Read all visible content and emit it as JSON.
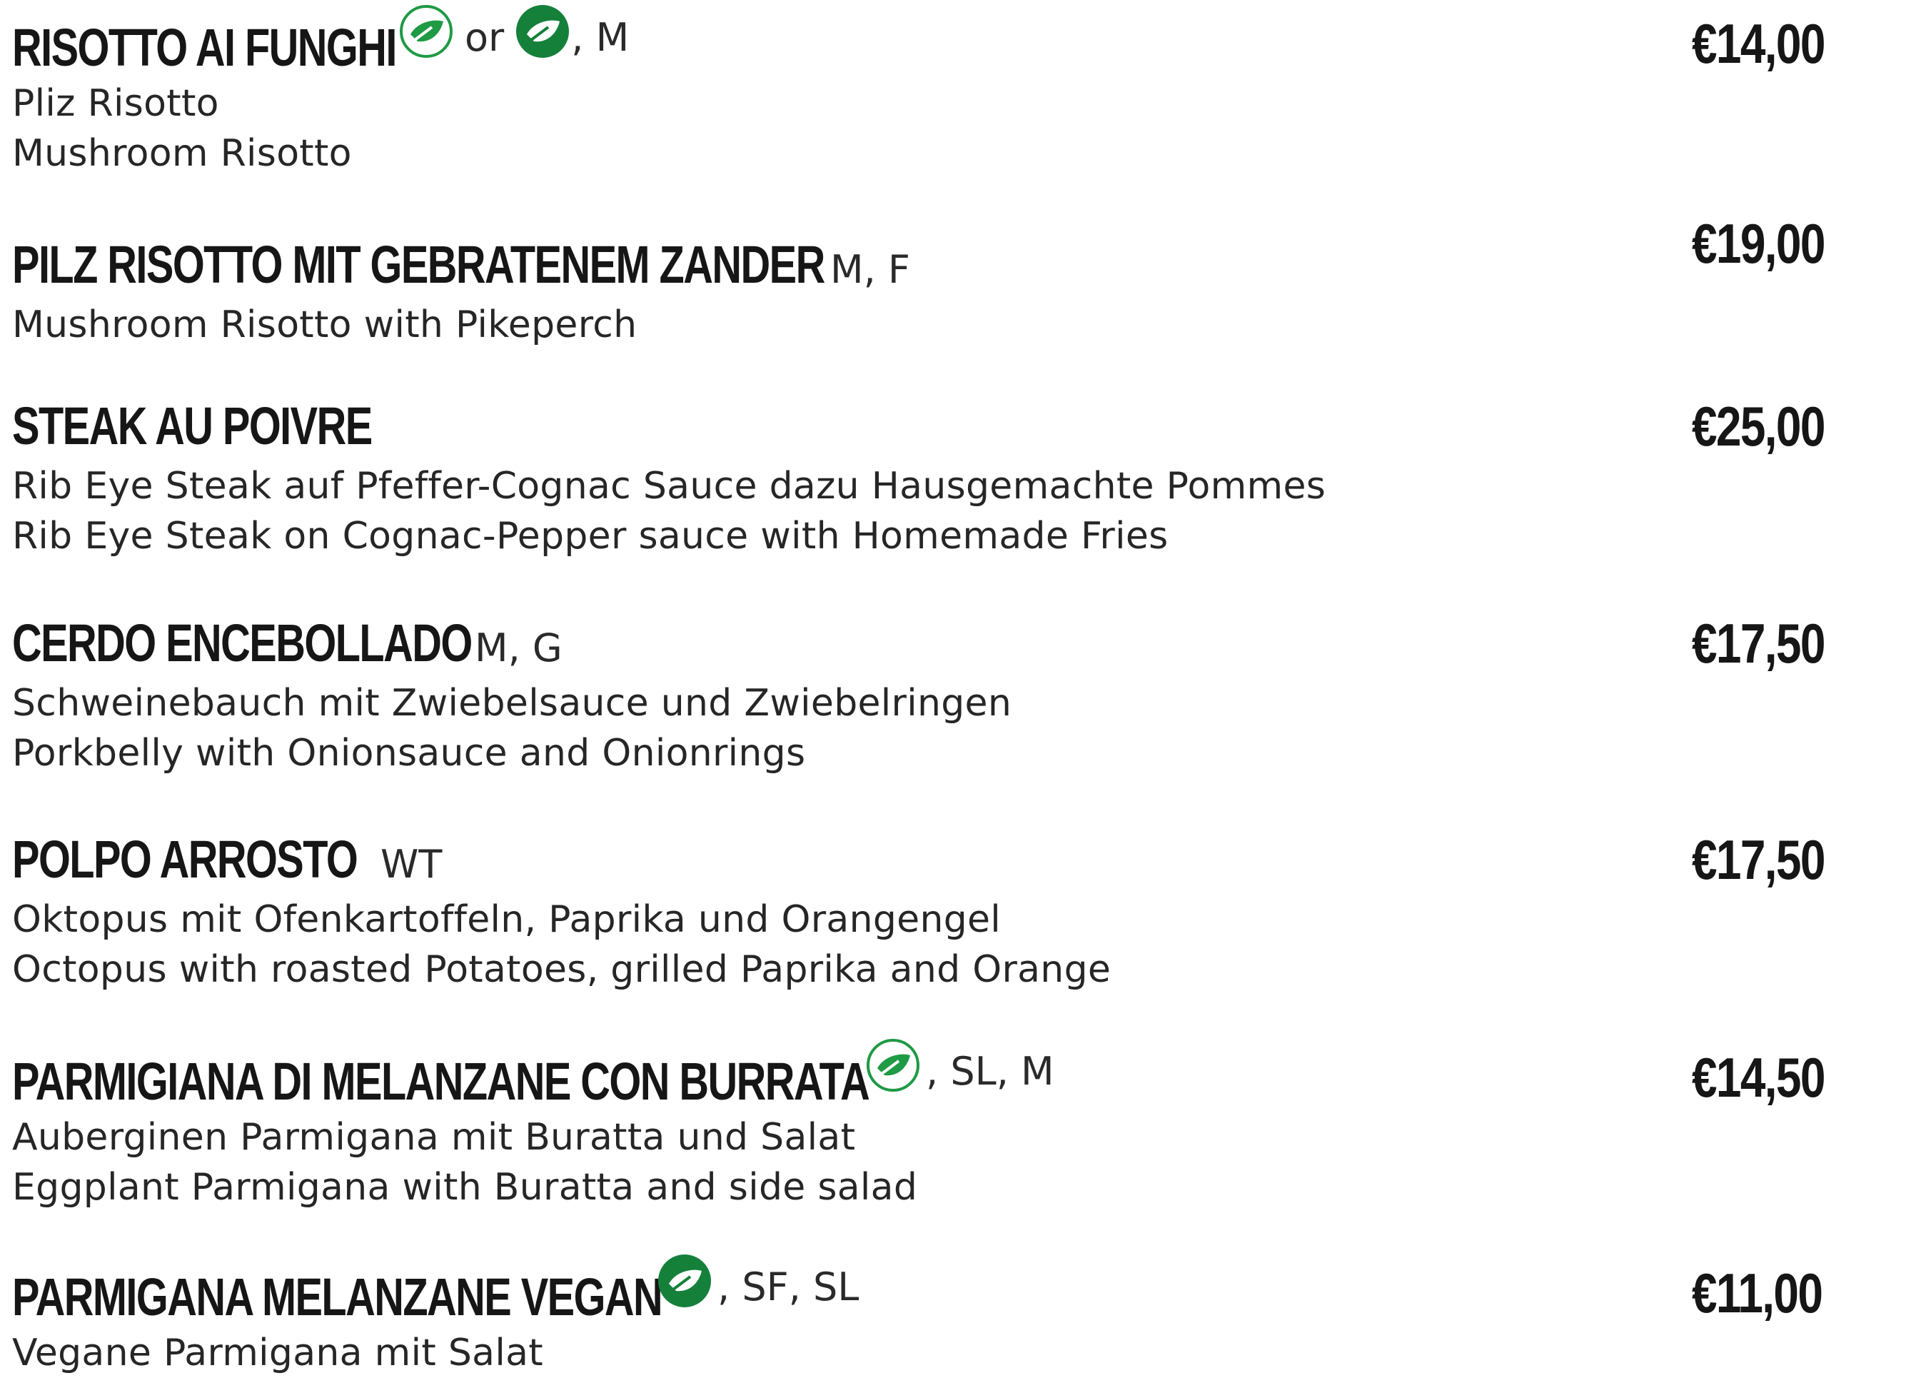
{
  "items": [
    {
      "name": "RISOTTO AI FUNGHI",
      "tags_parts": [
        "or",
        ", M"
      ],
      "icons": [
        "vegetarian-leaf-outline",
        "vegan-leaf-solid"
      ],
      "desc": [
        "Pliz Risotto",
        "Mushroom Risotto"
      ],
      "price": "€14,00"
    },
    {
      "name": "PILZ RISOTTO MIT GEBRATENEM ZANDER",
      "tags": "M, F",
      "desc": [
        "Mushroom Risotto with Pikeperch"
      ],
      "price": "€19,00"
    },
    {
      "name": "STEAK AU POIVRE",
      "tags": "",
      "desc": [
        "Rib Eye Steak auf Pfeffer-Cognac Sauce dazu Hausgemachte Pommes",
        "Rib Eye Steak on Cognac-Pepper sauce with Homemade Fries"
      ],
      "price": "€25,00"
    },
    {
      "name": "CERDO ENCEBOLLADO",
      "tags": "M, G",
      "desc": [
        "Schweinebauch mit Zwiebelsauce und Zwiebelringen",
        "Porkbelly with Onionsauce and Onionrings"
      ],
      "price": "€17,50"
    },
    {
      "name": "POLPO ARROSTO",
      "tags": "WT",
      "desc": [
        "Oktopus mit Ofenkartoffeln, Paprika und Orangengel",
        "Octopus with roasted Potatoes, grilled Paprika and Orange"
      ],
      "price": "€17,50"
    },
    {
      "name": "PARMIGIANA DI MELANZANE CON BURRATA",
      "tags": ", SL, M",
      "icons": [
        "vegetarian-leaf-outline"
      ],
      "desc": [
        "Auberginen Parmigana mit Buratta und Salat",
        "Eggplant Parmigana with Buratta and side salad"
      ],
      "price": "€14,50"
    },
    {
      "name": "PARMIGANA MELANZANE VEGAN",
      "tags": ", SF, SL",
      "icons": [
        "vegan-leaf-solid"
      ],
      "desc": [
        "Vegane Parmigana mit Salat"
      ],
      "price": "€11,00"
    }
  ],
  "colors": {
    "leaf_green": "#1f9a45",
    "leaf_dark": "#15803a",
    "text": "#1a1a1a"
  }
}
